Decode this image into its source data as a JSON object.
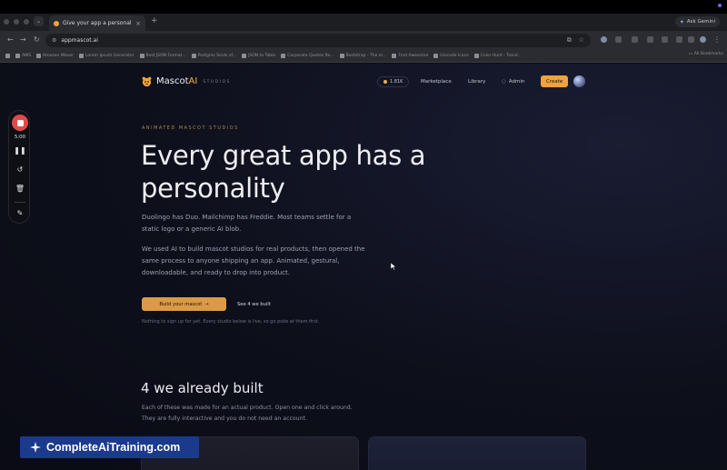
{
  "browser": {
    "tab_title": "Give your app a personality",
    "tab_close": "×",
    "new_tab": "+",
    "ask_gemini": "Ask Gemini",
    "url": "appmascot.ai",
    "bookmarks": [
      "AWS",
      "Amazon Waver",
      "Lorem Ipsum Generator",
      "Best JSON Format...",
      "Postgres Sinds of...",
      "JSON to Table",
      "Corporate Quotes Re...",
      "Bootstrap - The m...",
      "Font Awesome",
      "Unicode Icons",
      "Color Hunt - Trend..."
    ],
    "all_bookmarks": "All Bookmarks"
  },
  "site": {
    "brand": "Mascot",
    "brand_ai": "AI",
    "brand_sub": "STUDIOS",
    "stat_pill": "1.81K",
    "nav": {
      "marketplace": "Marketplace",
      "library": "Library",
      "admin": "Admin",
      "create": "Create"
    }
  },
  "hero": {
    "eyebrow": "ANIMATED MASCOT STUDIOS",
    "headline_line1": "Every great app has a",
    "headline_line2": "personality",
    "p1_line1": "Duolingo has Duo. Mailchimp has Freddie. Most teams settle for a",
    "p1_line2": "static logo or a generic AI blob.",
    "p2_line1": "We used AI to build mascot studios for real products, then opened the",
    "p2_line2": "same process to anyone shipping an app. Animated, gestural,",
    "p2_line3": "downloadable, and ready to drop into product.",
    "cta_primary": "Build your mascot",
    "cta_arrow": "→",
    "cta_secondary": "See 4 we built",
    "hint": "Nothing to sign up for yet. Every studio below is live, so go poke at them first."
  },
  "built": {
    "title": "4 we already built",
    "desc_line1": "Each of these was made for an actual product. Open one and click around.",
    "desc_line2": "They are fully interactive and you do not need an account."
  },
  "recorder": {
    "time": "5:00"
  },
  "watermark": {
    "text": "CompleteAiTraining.com"
  },
  "colors": {
    "accent": "#f0a23f",
    "page_bg": "#0b0d16",
    "record_red": "#e24a4a",
    "watermark_bg": "#1b3a8c"
  }
}
